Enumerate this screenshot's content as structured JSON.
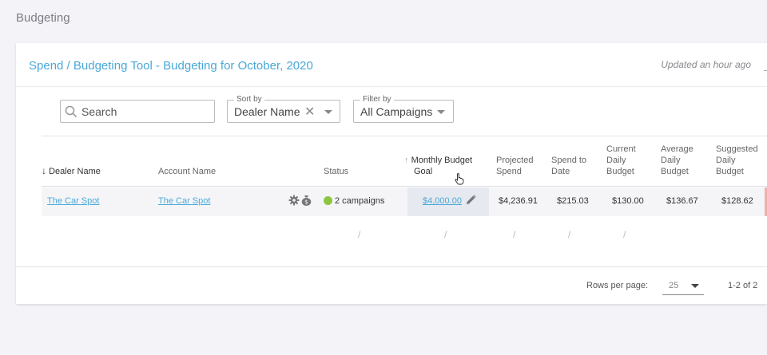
{
  "page": {
    "title": "Budgeting"
  },
  "card": {
    "title": "Spend / Budgeting Tool - Budgeting for October, 2020",
    "updated": "Updated an hour ago"
  },
  "toolbar": {
    "search_placeholder": "Search",
    "sort": {
      "legend": "Sort by",
      "value": "Dealer Name"
    },
    "filter": {
      "legend": "Filter by",
      "value": "All Campaigns"
    }
  },
  "table": {
    "headers": {
      "dealer": "Dealer Name",
      "account": "Account Name",
      "status": "Status",
      "monthly_l1": "Monthly Budget",
      "monthly_l2": "Goal",
      "projected_l1": "Projected",
      "projected_l2": "Spend",
      "spend_l1": "Spend to",
      "spend_l2": "Date",
      "current_l1": "Current",
      "current_l2": "Daily",
      "current_l3": "Budget",
      "average_l1": "Average",
      "average_l2": "Daily",
      "average_l3": "Budget",
      "suggested_l1": "Suggested",
      "suggested_l2": "Daily",
      "suggested_l3": "Budget"
    },
    "rows": [
      {
        "dealer": "The Car Spot",
        "account": "The Car Spot",
        "status": "2 campaigns",
        "monthly_goal": "$4,000.00",
        "projected": "$4,236.91",
        "spend_to_date": "$215.03",
        "current_daily": "$130.00",
        "average_daily": "$136.67",
        "suggested_daily": "$128.62"
      }
    ]
  },
  "footer": {
    "rows_per_page_label": "Rows per page:",
    "rows_per_page_value": "25",
    "range": "1-2 of 2"
  },
  "colors": {
    "accent": "#4aa8d8",
    "status_ok": "#8cc63f"
  }
}
